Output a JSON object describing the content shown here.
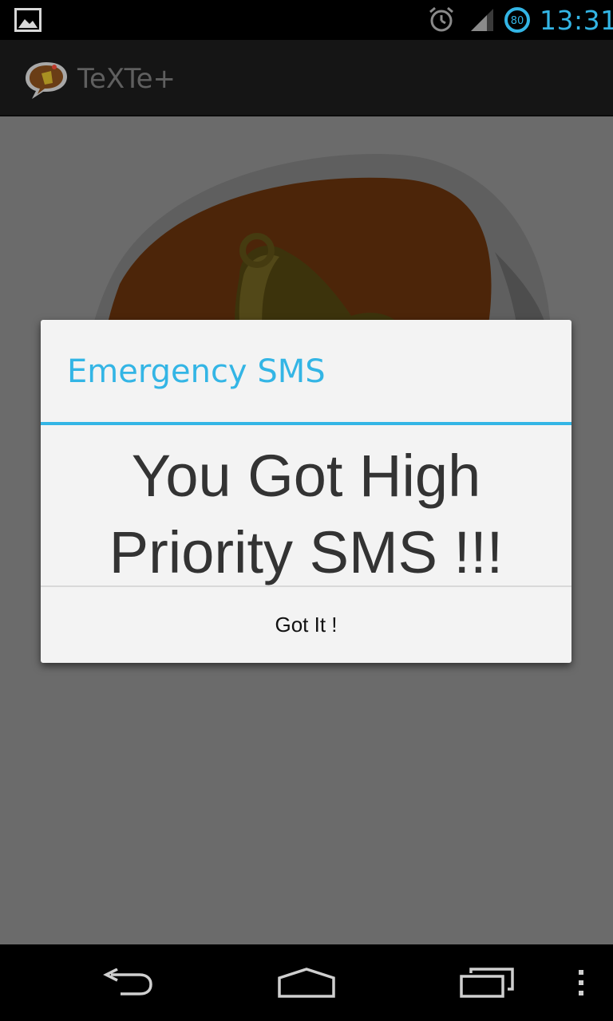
{
  "status_bar": {
    "time": "13:31",
    "battery_level": "80",
    "icons": [
      "image-notification-icon",
      "alarm-icon",
      "signal-icon",
      "battery-icon"
    ]
  },
  "action_bar": {
    "app_title": "TeXTe+",
    "logo_icon": "bell-speech-bubble-icon"
  },
  "dialog": {
    "title": "Emergency SMS",
    "message_line1": "You Got High",
    "message_line2": "Priority SMS !!!",
    "button_label": "Got It !"
  },
  "nav_bar": {
    "icons": [
      "back-icon",
      "home-icon",
      "recent-apps-icon",
      "overflow-menu-icon"
    ]
  },
  "colors": {
    "accent": "#33b5e5",
    "dialog_background": "#f3f3f3",
    "message_text": "#333333",
    "action_bar": "#151515"
  }
}
